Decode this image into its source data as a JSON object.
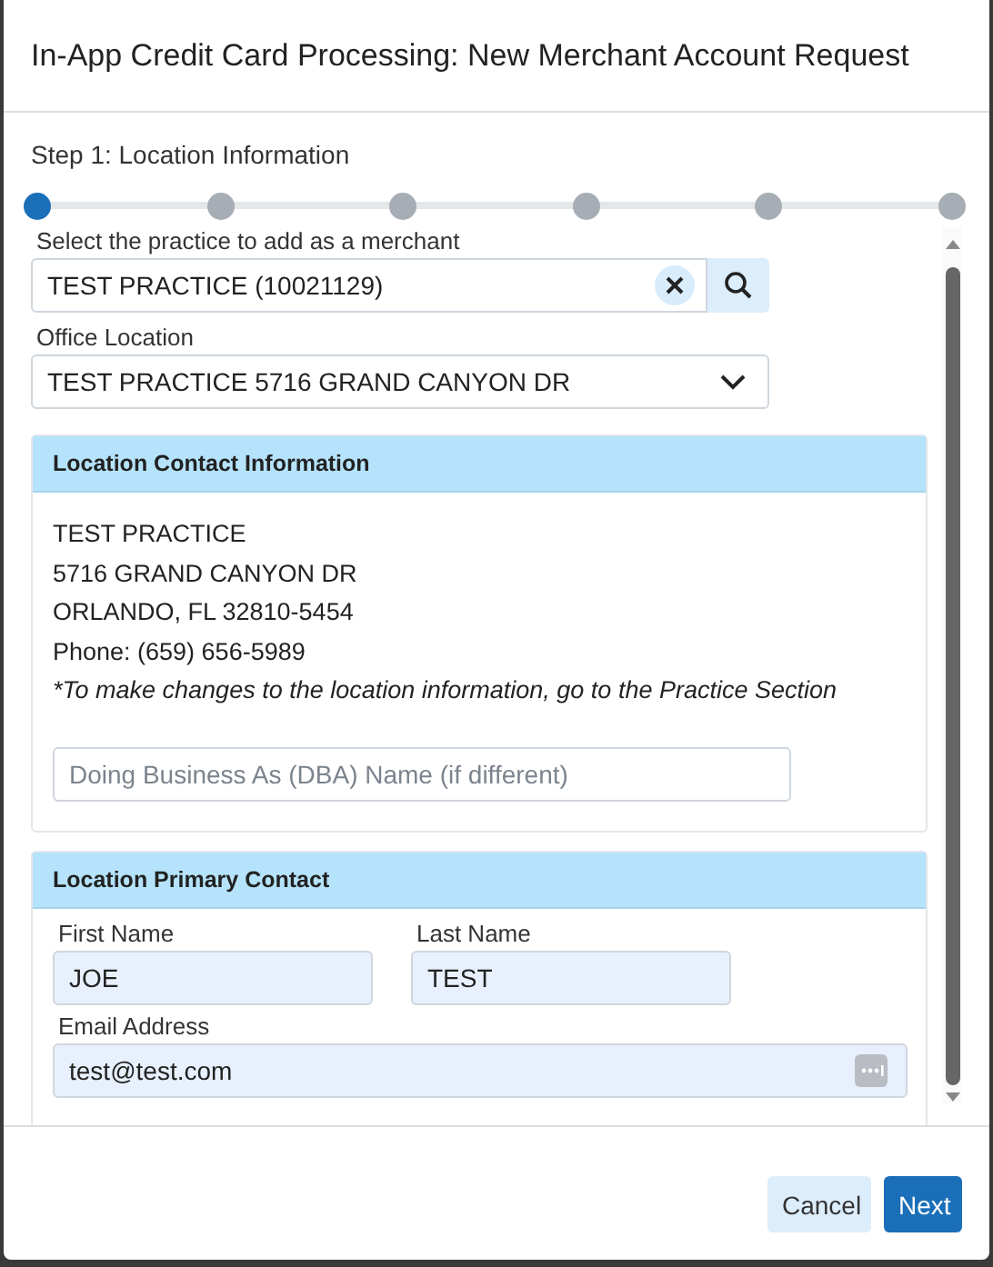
{
  "dialog": {
    "title": "In-App Credit Card Processing: New Merchant Account Request"
  },
  "step_label": "Step 1: Location Information",
  "steps": [
    {
      "selected": true
    },
    {
      "selected": false
    },
    {
      "selected": false
    },
    {
      "selected": false
    },
    {
      "selected": false
    },
    {
      "selected": false
    }
  ],
  "practice_search": {
    "label": "Select the practice to add as a merchant",
    "value": "TEST PRACTICE (10021129)"
  },
  "office_location": {
    "label": "Office Location",
    "value": "TEST PRACTICE 5716 GRAND CANYON DR"
  },
  "location_contact": {
    "heading": "Location Contact Information",
    "lines": [
      "TEST PRACTICE",
      "5716 GRAND CANYON DR",
      "ORLANDO, FL 32810-5454",
      "Phone: (659) 656-5989"
    ],
    "note": "*To make changes to the location information, go to the Practice Section",
    "dba_field": {
      "placeholder": "Doing Business As (DBA) Name (if different)"
    }
  },
  "primary_contact": {
    "heading": "Location Primary Contact",
    "first_name": {
      "label": "First Name",
      "value": "JOE"
    },
    "last_name": {
      "label": "Last Name",
      "value": "TEST"
    },
    "email": {
      "label": "Email Address",
      "value": "test@test.com"
    }
  },
  "buttons": {
    "cancel": "Cancel",
    "next": "Next"
  }
}
